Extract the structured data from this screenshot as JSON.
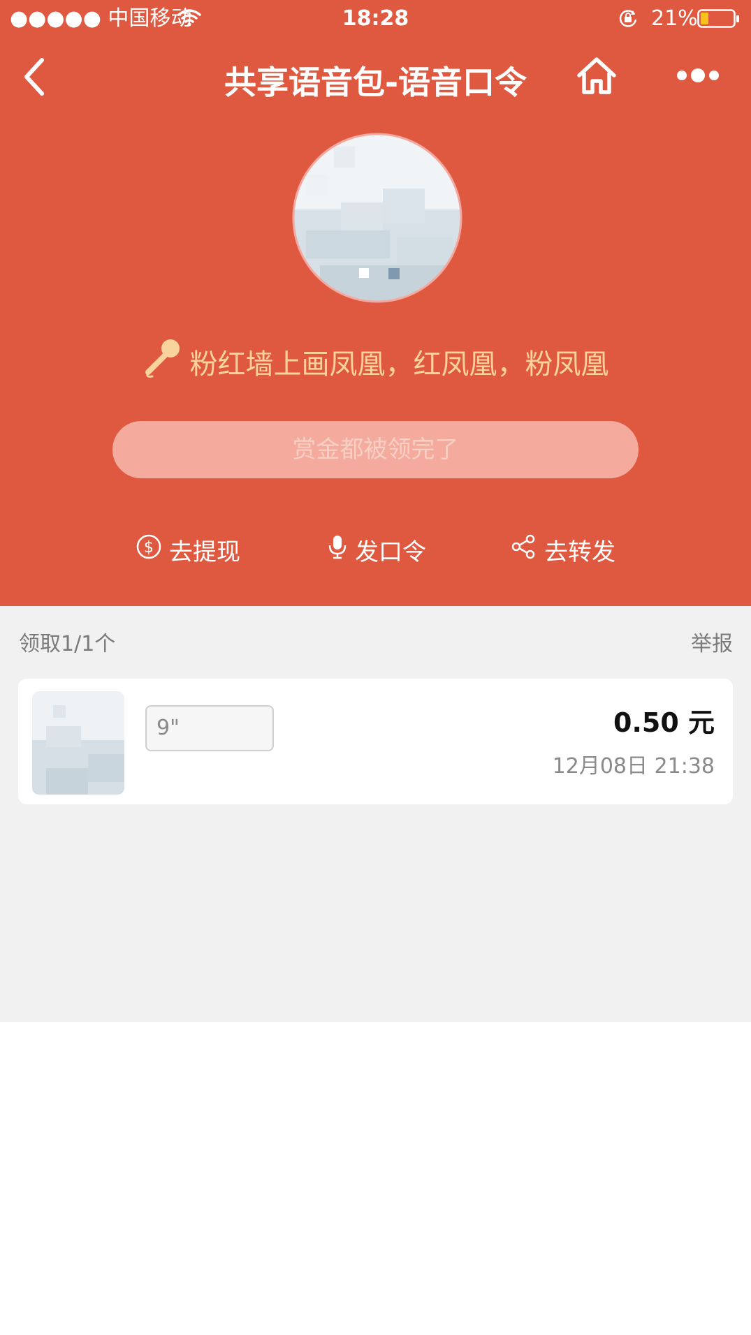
{
  "status_bar": {
    "carrier": "●●●●● 中国移动",
    "time": "18:28",
    "battery": "21%"
  },
  "nav": {
    "title": "共享语音包-语音口令",
    "back_icon": "chevron-left-icon",
    "home_icon": "home-icon",
    "more_icon": "more-dots-icon"
  },
  "voice_prompt": {
    "icon": "microphone-icon",
    "text": "粉红墙上画凤凰，红凤凰，粉凤凰"
  },
  "status_button": {
    "label": "赏金都被领完了"
  },
  "actions": [
    {
      "icon": "dollar-icon",
      "label": "去提现"
    },
    {
      "icon": "mic-icon",
      "label": "发口令"
    },
    {
      "icon": "share-icon",
      "label": "去转发"
    }
  ],
  "claims": {
    "summary": "领取1/1个",
    "report": "举报",
    "items": [
      {
        "duration": "9\"",
        "amount": "0.50 元",
        "time": "12月08日 21:38"
      }
    ]
  },
  "colors": {
    "header_bg": "#df5941",
    "prompt_text": "#f9d39c",
    "content_bg": "#f1f1f1"
  }
}
